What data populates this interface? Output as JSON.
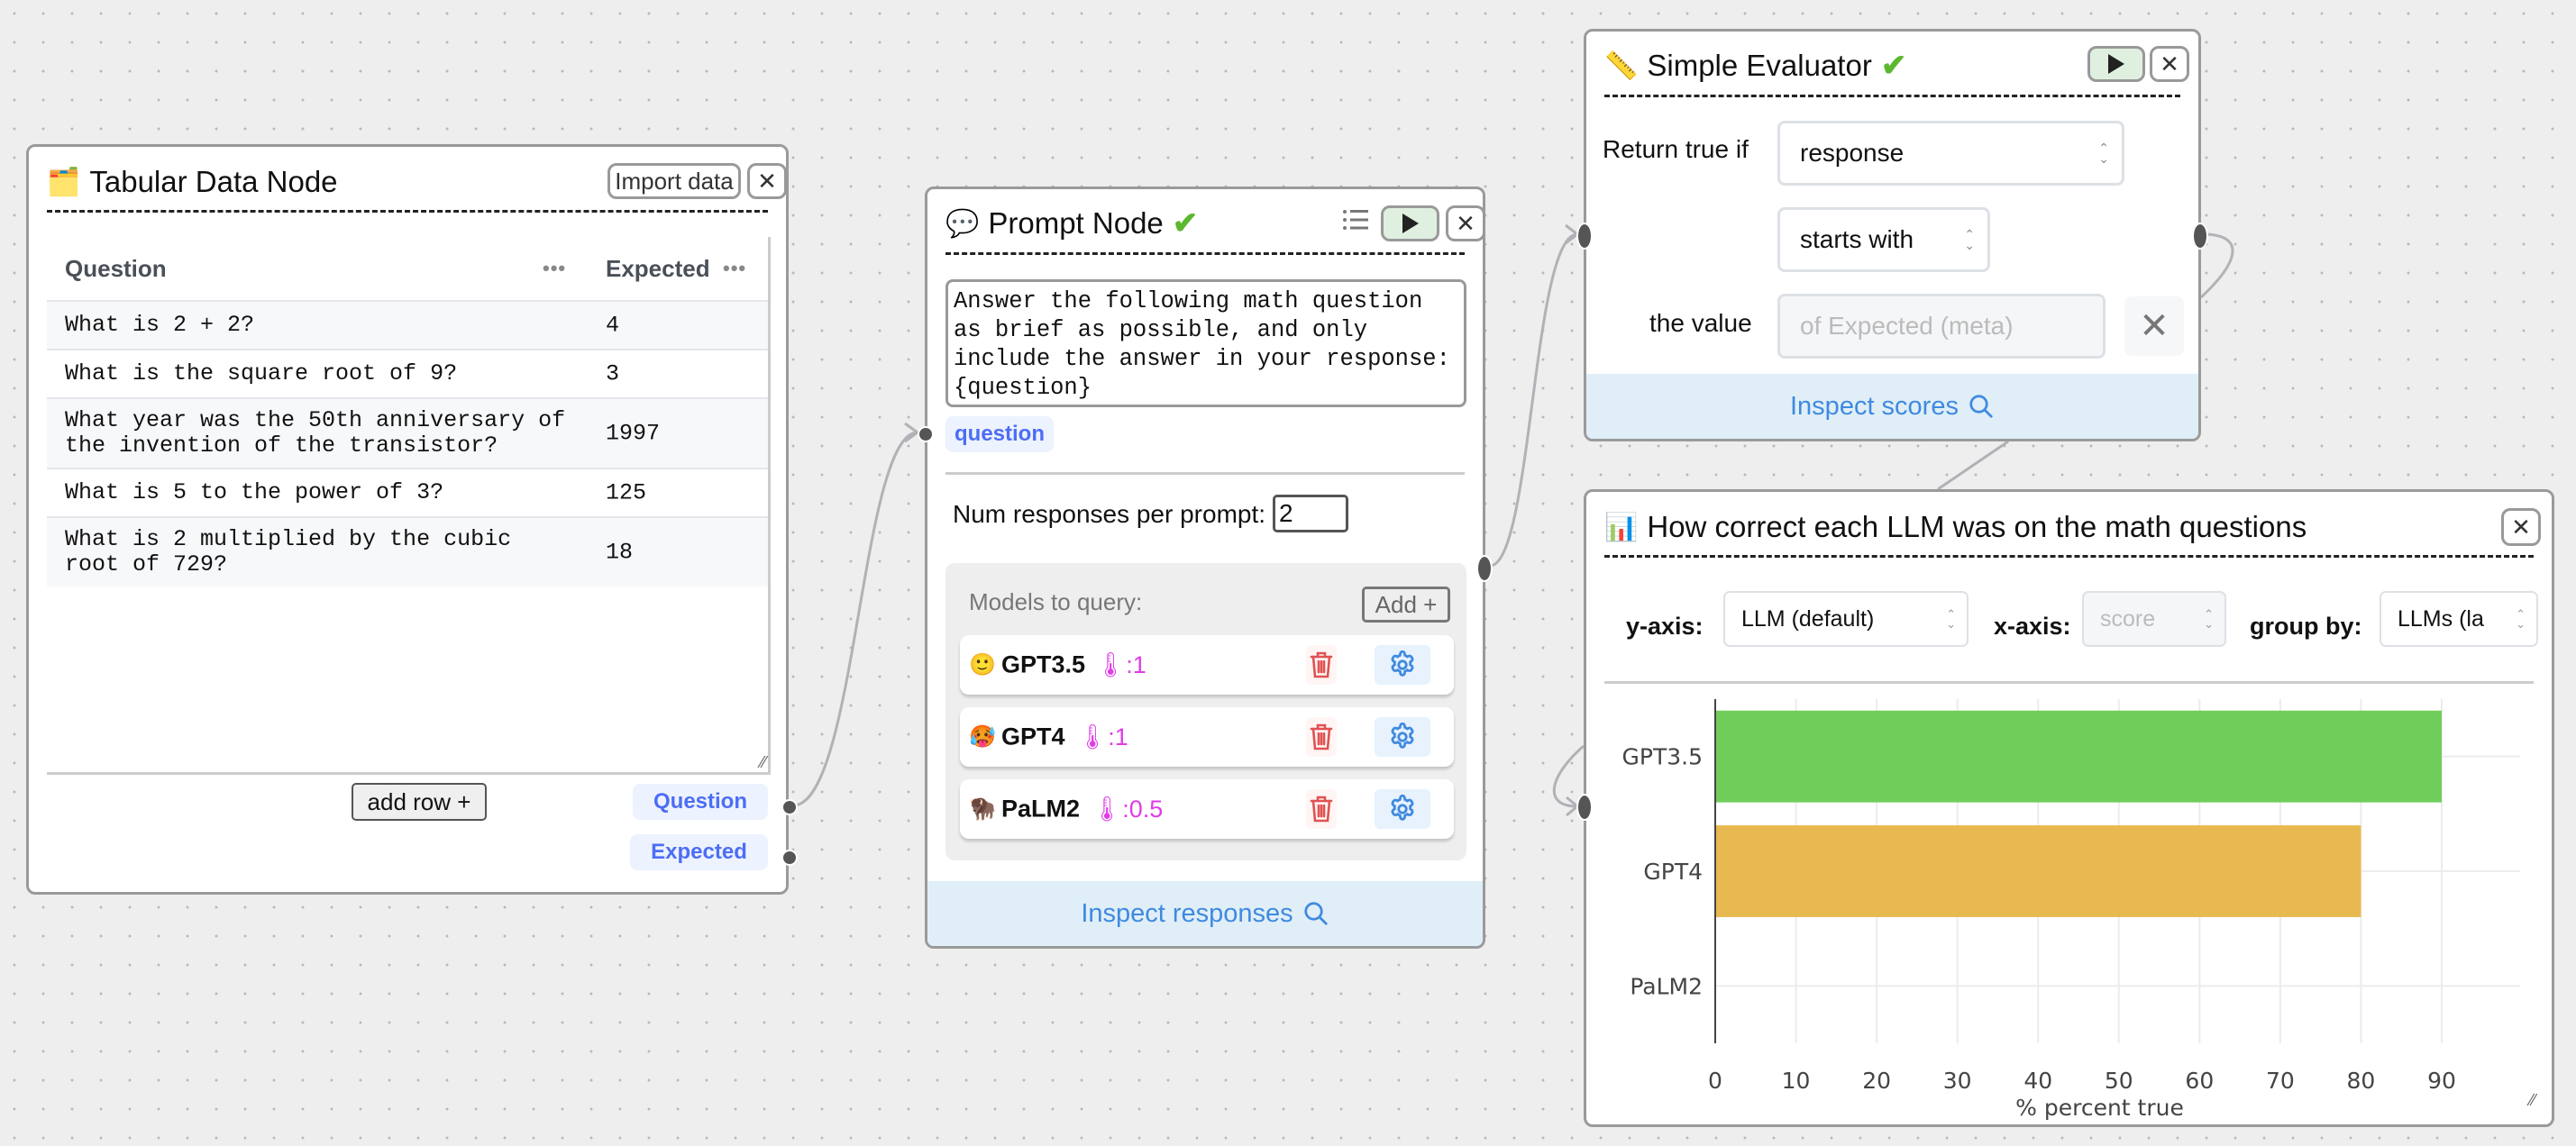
{
  "tabular_node": {
    "icon": "card-index-dividers-icon",
    "icon_glyph": "🗂️",
    "title": "Tabular Data Node",
    "import_label": "Import data",
    "close_glyph": "✕",
    "columns": [
      "Question",
      "Expected"
    ],
    "column_menu_glyph": "•••",
    "rows": [
      {
        "question": "What is 2 + 2?",
        "expected": "4"
      },
      {
        "question": "What is the square root of 9?",
        "expected": "3"
      },
      {
        "question": "What year was the 50th anniversary of the invention of the transistor?",
        "expected": "1997"
      },
      {
        "question": "What is 5 to the power of 3?",
        "expected": "125"
      },
      {
        "question": "What is 2 multiplied by the cubic root of 729?",
        "expected": "18"
      }
    ],
    "add_row_label": "add row +",
    "outputs": [
      "Question",
      "Expected"
    ]
  },
  "prompt_node": {
    "icon_glyph": "💬",
    "title": "Prompt Node",
    "status_glyph": "✔",
    "prompt_text": "Answer the following math question as brief as possible, and only include the answer in your response: {question}",
    "template_vars": [
      "question"
    ],
    "num_responses_label": "Num responses per prompt:",
    "num_responses_value": "2",
    "models_label": "Models to query:",
    "add_model_label": "Add +",
    "models": [
      {
        "emoji": "🙂",
        "name": "GPT3.5",
        "temperature": "🌡:1",
        "temp_value": "1"
      },
      {
        "emoji": "🥵",
        "name": "GPT4",
        "temperature": "🌡:1",
        "temp_value": "1"
      },
      {
        "emoji": "🦬",
        "name": "PaLM2",
        "temperature": "🌡:0.5",
        "temp_value": "0.5"
      }
    ],
    "inspect_label": "Inspect responses"
  },
  "evaluator_node": {
    "icon_glyph": "📏",
    "title": "Simple Evaluator",
    "status_glyph": "✔",
    "return_label": "Return true if",
    "target_select": "response",
    "operator_select": "starts with",
    "value_label": "the value",
    "value_placeholder": "of Expected (meta)",
    "inspect_label": "Inspect scores"
  },
  "vis_node": {
    "icon_glyph": "📊",
    "title": "How correct each LLM was on the math questions",
    "y_axis_label": "y-axis:",
    "y_axis_value": "LLM (default)",
    "x_axis_label": "x-axis:",
    "x_axis_value": "score",
    "group_by_label": "group by:",
    "group_by_value": "LLMs (la"
  },
  "colors": {
    "accent_blue": "#3f8ae0",
    "badge_blue": "#4c6ef5",
    "temperature_magenta": "#e03ce8",
    "success_green": "#5cb82e",
    "delete_red": "#e05252"
  },
  "chart_data": {
    "type": "bar",
    "orientation": "horizontal",
    "title": "",
    "categories": [
      "GPT3.5",
      "GPT4",
      "PaLM2"
    ],
    "values": [
      90,
      80,
      0
    ],
    "colors": [
      "#70cd5a",
      "#e8b950",
      "#cccccc"
    ],
    "xlabel": "% percent true",
    "ylabel": "",
    "xlim": [
      0,
      100
    ],
    "xticks": [
      0,
      10,
      20,
      30,
      40,
      50,
      60,
      70,
      80,
      90
    ],
    "grid": true,
    "legend": "none"
  }
}
